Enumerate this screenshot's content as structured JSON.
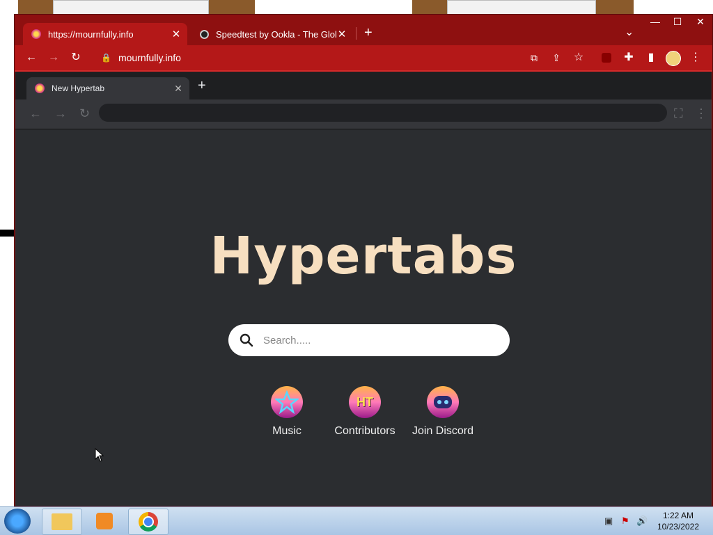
{
  "browser": {
    "tabs": [
      {
        "title": "https://mournfully.info",
        "active": true
      },
      {
        "title": "Speedtest by Ookla - The Global",
        "active": false
      }
    ],
    "new_tab_symbol": "+",
    "tab_list_symbol": "⌄",
    "url": "mournfully.info",
    "accent_color": "#b41818"
  },
  "inner": {
    "tab_title": "New Hypertab",
    "new_tab_symbol": "+"
  },
  "page": {
    "title": "Hypertabs",
    "search_placeholder": "Search.....",
    "shortcuts": [
      {
        "label": "Music",
        "icon": "star-icon"
      },
      {
        "label": "Contributors",
        "icon": "ht-logo-icon",
        "badge": "HT"
      },
      {
        "label": "Join Discord",
        "icon": "discord-icon"
      }
    ]
  },
  "taskbar": {
    "time": "1:22 AM",
    "date": "10/23/2022"
  }
}
